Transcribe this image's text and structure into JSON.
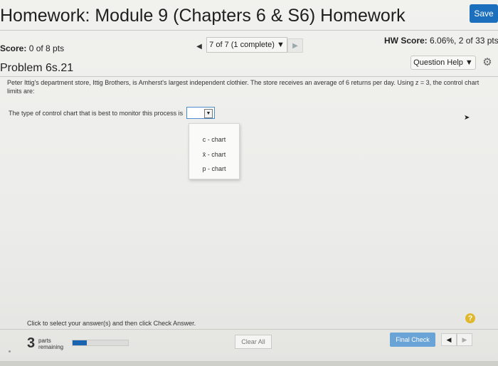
{
  "header": {
    "title": "Homework: Module 9 (Chapters 6 & S6) Homework",
    "save_label": "Save"
  },
  "score": {
    "label": "Score:",
    "value": "0 of 8 pts"
  },
  "question_nav": {
    "position_text": "7 of 7 (1 complete) ▼"
  },
  "hw_score": {
    "label": "HW Score:",
    "value": "6.06%, 2 of 33 pts"
  },
  "problem": {
    "title": "Problem 6s.21",
    "help_label": "Question Help ▼",
    "statement": "Peter Ittig's department store, Ittig Brothers, is Amherst's largest independent clothier. The store receives an average of 6 returns per day. Using z = 3, the control chart limits are:",
    "question_text": "The type of control chart that is best to monitor this process is",
    "dropdown_options": [
      "c - chart",
      "x̄ - chart",
      "p - chart"
    ]
  },
  "footer": {
    "instruction": "Click to select your answer(s) and then click Check Answer.",
    "parts_count": "3",
    "parts_label_1": "parts",
    "parts_label_2": "remaining",
    "progress_fraction": 0.25,
    "clear_label": "Clear All",
    "final_label": "Final Check"
  }
}
